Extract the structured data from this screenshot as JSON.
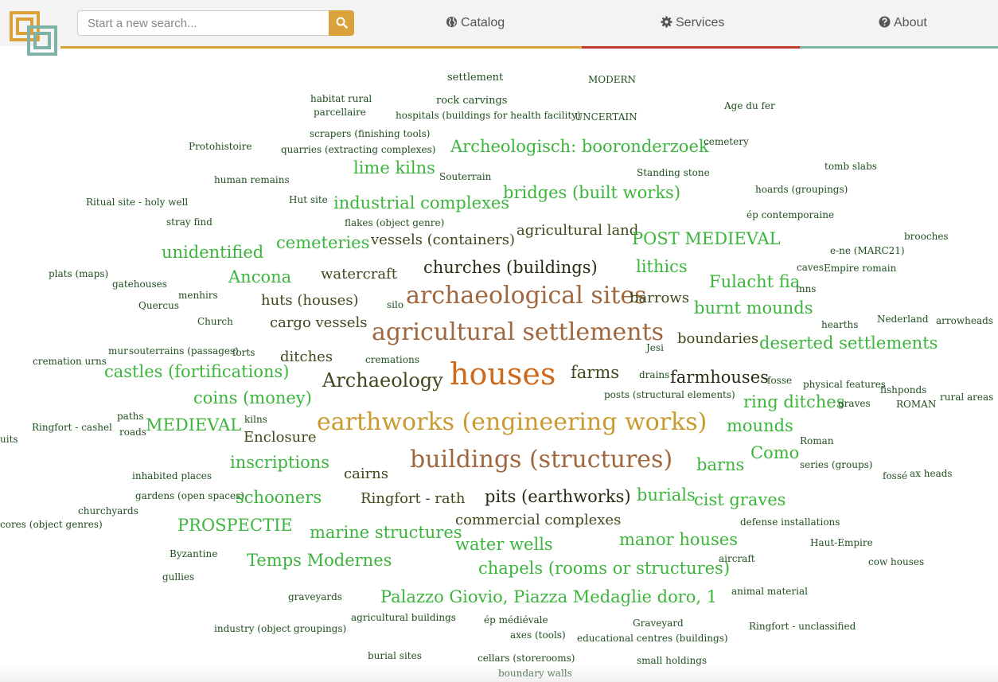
{
  "header": {
    "search": {
      "placeholder": "Start a new search...",
      "value": "",
      "button_icon": "search-icon"
    },
    "nav": [
      {
        "label": "Catalog",
        "icon": "globe-icon"
      },
      {
        "label": "Services",
        "icon": "gear-icon"
      },
      {
        "label": "About",
        "icon": "question-circle-icon"
      }
    ],
    "accent_bars": [
      "#dba23c",
      "#c0392b",
      "#7fb3a8"
    ]
  },
  "colors": {
    "huge": "#cc6a1e",
    "large_brown": "#a0673e",
    "large_gold": "#c99a2e",
    "medium_green": "#3cb53c",
    "dark_olive": "#3f4a1c",
    "dark": "#2a2a12",
    "small": "#1f4f1f"
  },
  "cloud": [
    "settlement",
    "MODERN",
    "habitat rural",
    "rock carvings",
    "parcellaire",
    "hospitals (buildings for health facility)",
    "UNCERTAIN",
    "Age du fer",
    "scrapers (finishing tools)",
    "Protohistoire",
    "quarries (extracting complexes)",
    "Archeologisch: booronderzoek",
    "cemetery",
    "lime kilns",
    "Standing stone",
    "tomb slabs",
    "human remains",
    "Souterrain",
    "Hut site",
    "bridges (built works)",
    "hoards (groupings)",
    "Ritual site - holy well",
    "industrial complexes",
    "stray find",
    "flakes (object genre)",
    "ép contemporaine",
    "agricultural land",
    "POST MEDIEVAL",
    "cemeteries",
    "vessels (containers)",
    "brooches",
    "unidentified",
    "e-ne (MARC21)",
    "lithics",
    "churches (buildings)",
    "caves",
    "Empire romain",
    "plats (maps)",
    "Ancona",
    "watercraft",
    "Fulacht fia",
    "gatehouses",
    "inns",
    "archaeological sites",
    "menhirs",
    "huts (houses)",
    "silo",
    "barrows",
    "Quercus",
    "burnt mounds",
    "Church",
    "cargo vessels",
    "Nederland",
    "arrowheads",
    "hearths",
    "agricultural settlements",
    "boundaries",
    "deserted settlements",
    "mur",
    "souterrains (passages)",
    "forts",
    "Jesi",
    "cremation urns",
    "ditches",
    "cremations",
    "houses",
    "castles (fortifications)",
    "farms",
    "drains",
    "farmhouses",
    "fosse",
    "Archaeology",
    "physical features",
    "fishponds",
    "posts (structural elements)",
    "coins (money)",
    "ring ditches",
    "graves",
    "rural areas",
    "ROMAN",
    "paths",
    "Ringfort - cashel",
    "kilns",
    "earthworks (engineering works)",
    "MEDIEVAL",
    "mounds",
    "roads",
    "uits",
    "Enclosure",
    "Roman",
    "Como",
    "buildings (structures)",
    "inscriptions",
    "barns",
    "series (groups)",
    "inhabited places",
    "cairns",
    "fossé",
    "ax heads",
    "gardens (open spaces)",
    "schooners",
    "Ringfort - rath",
    "pits (earthworks)",
    "burials",
    "cist graves",
    "churchyards",
    "cores (object genres)",
    "PROSPECTIE",
    "commercial complexes",
    "defense installations",
    "marine structures",
    "Haut-Empire",
    "manor houses",
    "water wells",
    "Byzantine",
    "aircraft",
    "cow houses",
    "Temps Modernes",
    "chapels (rooms or structures)",
    "gullies",
    "animal material",
    "graveyards",
    "Palazzo Giovio, Piazza Medaglie doro, 1",
    "agricultural buildings",
    "ép médiévale",
    "Graveyard",
    "industry (object groupings)",
    "axes (tools)",
    "Ringfort - unclassified",
    "educational centres (buildings)",
    "burial sites",
    "cellars (storerooms)",
    "small holdings",
    "boundary walls"
  ]
}
